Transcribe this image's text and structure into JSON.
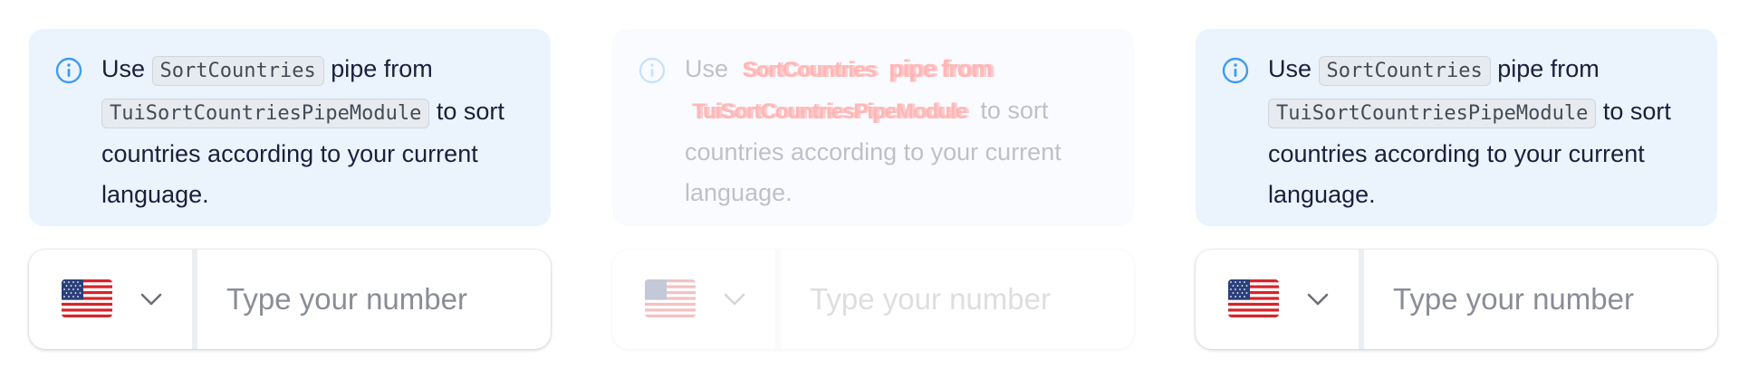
{
  "panels": [
    {
      "state": "normal",
      "notice": {
        "icon": "info-icon",
        "text_before": "Use ",
        "pipe_name": "SortCountries",
        "text_mid": " pipe from ",
        "module_name": "TuiSortCountriesPipeModule",
        "text_after": " to sort countries according to your current language."
      },
      "phone": {
        "country_flag": "us-flag-icon",
        "chevron": "chevron-down-icon",
        "placeholder": "Type your number",
        "value": ""
      }
    },
    {
      "state": "disabled",
      "notice": {
        "icon": "info-icon",
        "text_before": "Use ",
        "pipe_name": "SortCountries",
        "text_mid": " pipe from",
        "module_name": "TuiSortCountriesPipeModule",
        "text_after": " to sort countries according to your current language."
      },
      "phone": {
        "country_flag": "us-flag-icon",
        "chevron": "chevron-down-icon",
        "placeholder": "Type your number",
        "value": ""
      }
    },
    {
      "state": "normal",
      "notice": {
        "icon": "info-icon",
        "text_before": "Use ",
        "pipe_name": "SortCountries",
        "text_mid": " pipe from ",
        "module_name": "TuiSortCountriesPipeModule",
        "text_after": " to sort countries according to your current language."
      },
      "phone": {
        "country_flag": "us-flag-icon",
        "chevron": "chevron-down-icon",
        "placeholder": "Type your number",
        "value": ""
      }
    }
  ],
  "colors": {
    "notice_background": "#ebf4fd",
    "info_icon": "#3f9af0",
    "text": "#1b1f3b",
    "placeholder": "#8a8d96",
    "diff_highlight": "#ff0000"
  }
}
